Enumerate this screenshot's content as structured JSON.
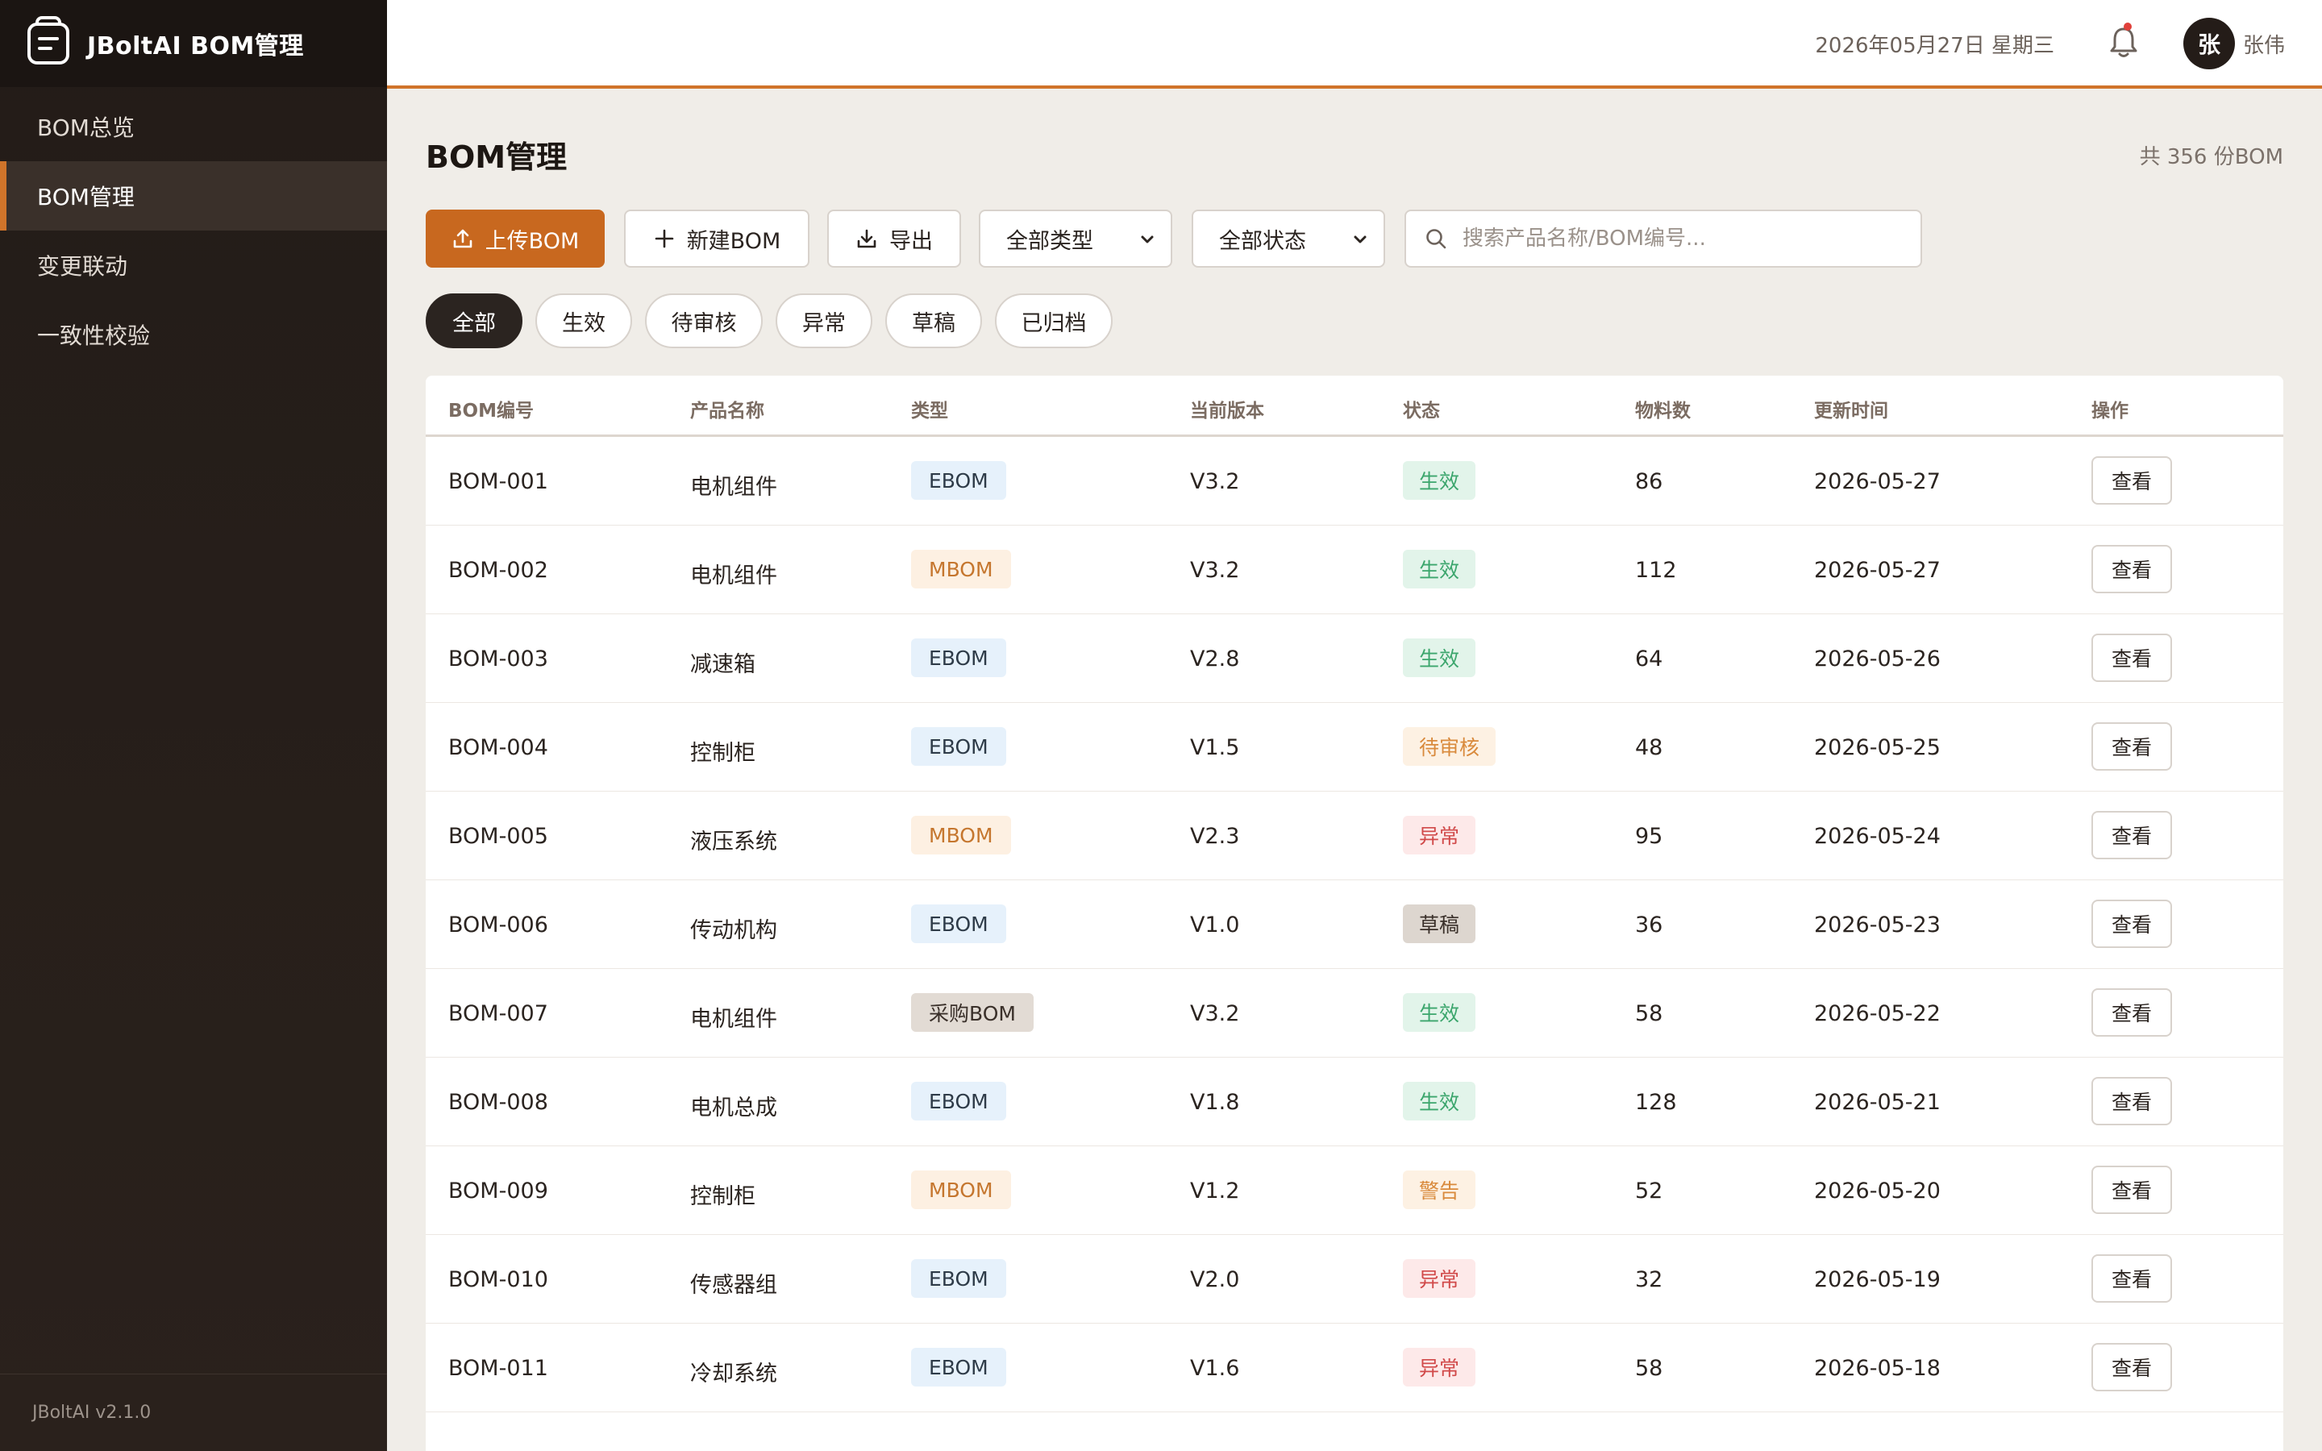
{
  "app": {
    "brand_title": "JBoltAI BOM管理",
    "version": "JBoltAI v2.1.0"
  },
  "sidebar": {
    "items": [
      {
        "label": "BOM总览",
        "active": false
      },
      {
        "label": "BOM管理",
        "active": true
      },
      {
        "label": "变更联动",
        "active": false
      },
      {
        "label": "一致性校验",
        "active": false
      }
    ]
  },
  "header": {
    "date": "2026年05月27日 星期三",
    "avatar_initial": "张",
    "user_name": "张伟"
  },
  "page": {
    "title": "BOM管理",
    "total": "共 356 份BOM"
  },
  "toolbar": {
    "upload_label": "上传BOM",
    "new_label": "新建BOM",
    "export_label": "导出",
    "type_select": "全部类型",
    "status_select": "全部状态",
    "search_placeholder": "搜索产品名称/BOM编号..."
  },
  "filters": [
    "全部",
    "生效",
    "待审核",
    "异常",
    "草稿",
    "已归档"
  ],
  "table": {
    "headers": [
      "BOM编号",
      "产品名称",
      "类型",
      "当前版本",
      "状态",
      "物料数",
      "更新时间",
      "操作"
    ],
    "view_label": "查看",
    "rows": [
      {
        "id": "BOM-001",
        "product": "电机组件",
        "type": "EBOM",
        "version": "V3.2",
        "status": "生效",
        "count": "86",
        "updated": "2026-05-27"
      },
      {
        "id": "BOM-002",
        "product": "电机组件",
        "type": "MBOM",
        "version": "V3.2",
        "status": "生效",
        "count": "112",
        "updated": "2026-05-27"
      },
      {
        "id": "BOM-003",
        "product": "减速箱",
        "type": "EBOM",
        "version": "V2.8",
        "status": "生效",
        "count": "64",
        "updated": "2026-05-26"
      },
      {
        "id": "BOM-004",
        "product": "控制柜",
        "type": "EBOM",
        "version": "V1.5",
        "status": "待审核",
        "count": "48",
        "updated": "2026-05-25"
      },
      {
        "id": "BOM-005",
        "product": "液压系统",
        "type": "MBOM",
        "version": "V2.3",
        "status": "异常",
        "count": "95",
        "updated": "2026-05-24"
      },
      {
        "id": "BOM-006",
        "product": "传动机构",
        "type": "EBOM",
        "version": "V1.0",
        "status": "草稿",
        "count": "36",
        "updated": "2026-05-23"
      },
      {
        "id": "BOM-007",
        "product": "电机组件",
        "type": "采购BOM",
        "version": "V3.2",
        "status": "生效",
        "count": "58",
        "updated": "2026-05-22"
      },
      {
        "id": "BOM-008",
        "product": "电机总成",
        "type": "EBOM",
        "version": "V1.8",
        "status": "生效",
        "count": "128",
        "updated": "2026-05-21"
      },
      {
        "id": "BOM-009",
        "product": "控制柜",
        "type": "MBOM",
        "version": "V1.2",
        "status": "警告",
        "count": "52",
        "updated": "2026-05-20"
      },
      {
        "id": "BOM-010",
        "product": "传感器组",
        "type": "EBOM",
        "version": "V2.0",
        "status": "异常",
        "count": "32",
        "updated": "2026-05-19"
      },
      {
        "id": "BOM-011",
        "product": "冷却系统",
        "type": "EBOM",
        "version": "V1.6",
        "status": "异常",
        "count": "58",
        "updated": "2026-05-18"
      }
    ]
  }
}
